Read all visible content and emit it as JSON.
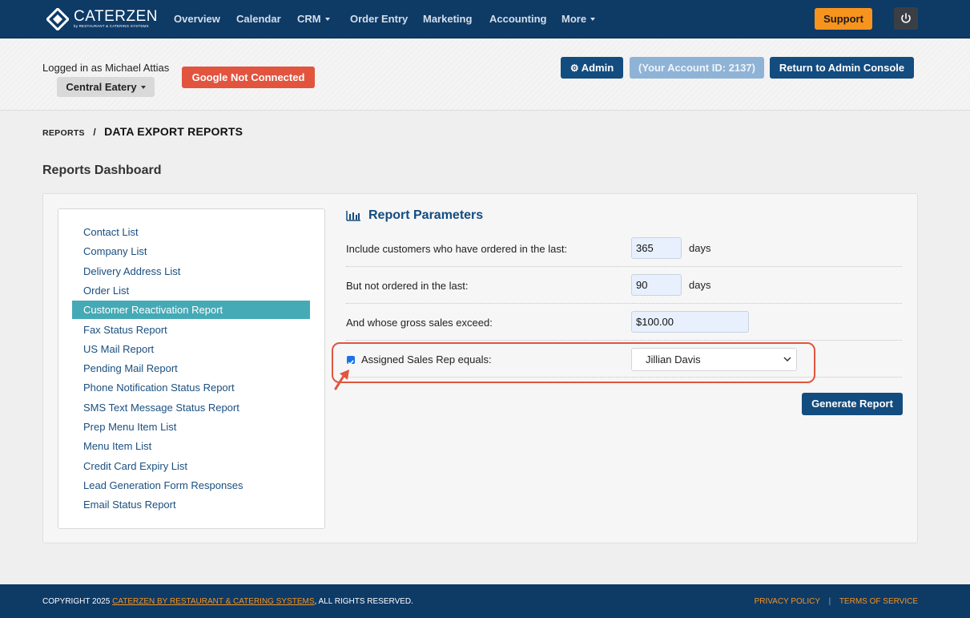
{
  "brand": {
    "name": "CATERZEN",
    "sub": "by RESTAURANT & CATERING SYSTEMS"
  },
  "nav": {
    "items": [
      {
        "label": "Overview"
      },
      {
        "label": "Calendar"
      },
      {
        "label": "CRM"
      },
      {
        "label": "Order Entry"
      },
      {
        "label": "Marketing"
      },
      {
        "label": "Accounting"
      },
      {
        "label": "More"
      }
    ],
    "support_label": "Support"
  },
  "account": {
    "logged_in": "Logged in as Michael Attias",
    "location": "Central Eatery",
    "google_status": "Google Not Connected",
    "admin_label": "Admin",
    "account_id": "(Your Account ID: 2137)",
    "return_label": "Return to Admin Console"
  },
  "breadcrumb": {
    "parent": "REPORTS",
    "separator": "/",
    "current": "DATA EXPORT REPORTS"
  },
  "page_title": "Reports Dashboard",
  "reports": [
    {
      "label": "Contact List"
    },
    {
      "label": "Company List"
    },
    {
      "label": "Delivery Address List"
    },
    {
      "label": "Order List"
    },
    {
      "label": "Customer Reactivation Report"
    },
    {
      "label": "Fax Status Report"
    },
    {
      "label": "US Mail Report"
    },
    {
      "label": "Pending Mail Report"
    },
    {
      "label": "Phone Notification Status Report"
    },
    {
      "label": "SMS Text Message Status Report"
    },
    {
      "label": "Prep Menu Item List"
    },
    {
      "label": "Menu Item List"
    },
    {
      "label": "Credit Card Expiry List"
    },
    {
      "label": "Lead Generation Form Responses"
    },
    {
      "label": "Email Status Report"
    }
  ],
  "active_report": "Customer Reactivation Report",
  "params": {
    "title": "Report Parameters",
    "ordered_last_label": "Include customers who have ordered in the last:",
    "ordered_last_value": "365",
    "not_ordered_label": "But not ordered in the last:",
    "not_ordered_value": "90",
    "days_unit": "days",
    "gross_label": "And whose gross sales exceed:",
    "gross_value": "$100.00",
    "sales_rep_label": "Assigned Sales Rep equals:",
    "sales_rep_checked": true,
    "sales_rep_value": "Jillian Davis",
    "generate_label": "Generate Report"
  },
  "footer": {
    "copyright_prefix": "COPYRIGHT 2025",
    "company_link": "CATERZEN BY RESTAURANT & CATERING SYSTEMS",
    "copyright_suffix": ", ALL RIGHTS RESERVED.",
    "privacy": "PRIVACY POLICY",
    "separator": "|",
    "terms": "TERMS OF SERVICE"
  },
  "colors": {
    "navbar": "#0e3a66",
    "primary": "#134c7f",
    "accent": "#f7941d",
    "danger": "#e2543e",
    "active_item": "#45aab5"
  }
}
